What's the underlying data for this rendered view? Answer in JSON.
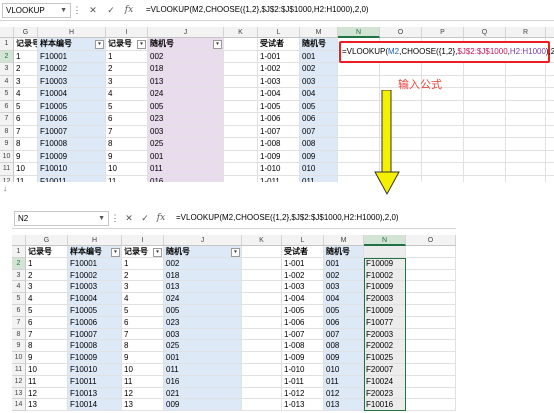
{
  "top": {
    "name_box": "VLOOKUP",
    "btn_more": "⋮",
    "btn_cancel": "✕",
    "btn_enter": "✓",
    "btn_fx": "fx",
    "formula": "=VLOOKUP(M2,CHOOSE({1,2},$J$2:$J$1000,H2:H1000),2,0)",
    "columns": [
      "G",
      "H",
      "I",
      "J",
      "K",
      "L",
      "M",
      "N",
      "O",
      "P",
      "Q",
      "R",
      "S"
    ],
    "rows": [
      "1",
      "2",
      "3",
      "4",
      "5",
      "6",
      "7",
      "8",
      "9",
      "10",
      "11",
      "12"
    ],
    "headers": {
      "g": "记录号",
      "h": "样本编号",
      "i": "记录号",
      "j": "随机号",
      "l": "受试者",
      "m": "随机号"
    },
    "data": [
      {
        "g": "1",
        "h": "F10001",
        "i": "1",
        "j": "002",
        "l": "1-001",
        "m": "001"
      },
      {
        "g": "2",
        "h": "F10002",
        "i": "2",
        "j": "018",
        "l": "1-002",
        "m": "002"
      },
      {
        "g": "3",
        "h": "F10003",
        "i": "3",
        "j": "013",
        "l": "1-003",
        "m": "003"
      },
      {
        "g": "4",
        "h": "F10004",
        "i": "4",
        "j": "024",
        "l": "1-004",
        "m": "004"
      },
      {
        "g": "5",
        "h": "F10005",
        "i": "5",
        "j": "005",
        "l": "1-005",
        "m": "005"
      },
      {
        "g": "6",
        "h": "F10006",
        "i": "6",
        "j": "023",
        "l": "1-006",
        "m": "006"
      },
      {
        "g": "7",
        "h": "F10007",
        "i": "7",
        "j": "003",
        "l": "1-007",
        "m": "007"
      },
      {
        "g": "8",
        "h": "F10008",
        "i": "8",
        "j": "025",
        "l": "1-008",
        "m": "008"
      },
      {
        "g": "9",
        "h": "F10009",
        "i": "9",
        "j": "001",
        "l": "1-009",
        "m": "009"
      },
      {
        "g": "10",
        "h": "F10010",
        "i": "10",
        "j": "011",
        "l": "1-010",
        "m": "010"
      },
      {
        "g": "11",
        "h": "F10011",
        "i": "11",
        "j": "016",
        "l": "1-011",
        "m": "011"
      }
    ],
    "editing_formula": {
      "part1": "=VLOOKUP(",
      "part2": "M2",
      "part3": ",CHOOSE({1,2},",
      "part4": "$J$2:$J$1000",
      "part5": ",",
      "part6": "H2:H1000",
      "part7": "),2,0)"
    },
    "annotation": "输入公式"
  },
  "arrow_note": "↓",
  "bottom": {
    "name_box": "N2",
    "btn_more": "⋮",
    "btn_cancel": "✕",
    "btn_enter": "✓",
    "btn_fx": "fx",
    "formula": "=VLOOKUP(M2,CHOOSE({1,2},$J$2:$J$1000,H2:H1000),2,0)",
    "columns": [
      "G",
      "H",
      "I",
      "J",
      "K",
      "L",
      "M",
      "N",
      "O"
    ],
    "rows": [
      "1",
      "2",
      "3",
      "4",
      "5",
      "6",
      "7",
      "8",
      "9",
      "10",
      "11",
      "12",
      "13",
      "14"
    ],
    "headers": {
      "g": "记录号",
      "h": "样本编号",
      "i": "记录号",
      "j": "随机号",
      "l": "受试者",
      "m": "随机号"
    },
    "data": [
      {
        "g": "1",
        "h": "F10001",
        "i": "1",
        "j": "002",
        "l": "1-001",
        "m": "001",
        "n": "F10009"
      },
      {
        "g": "2",
        "h": "F10002",
        "i": "2",
        "j": "018",
        "l": "1-002",
        "m": "002",
        "n": "F10002"
      },
      {
        "g": "3",
        "h": "F10003",
        "i": "3",
        "j": "013",
        "l": "1-003",
        "m": "003",
        "n": "F10009"
      },
      {
        "g": "4",
        "h": "F10004",
        "i": "4",
        "j": "024",
        "l": "1-004",
        "m": "004",
        "n": "F20003"
      },
      {
        "g": "5",
        "h": "F10005",
        "i": "5",
        "j": "005",
        "l": "1-005",
        "m": "005",
        "n": "F10009"
      },
      {
        "g": "6",
        "h": "F10006",
        "i": "6",
        "j": "023",
        "l": "1-006",
        "m": "006",
        "n": "F10077"
      },
      {
        "g": "7",
        "h": "F10007",
        "i": "7",
        "j": "003",
        "l": "1-007",
        "m": "007",
        "n": "F20003"
      },
      {
        "g": "8",
        "h": "F10008",
        "i": "8",
        "j": "025",
        "l": "1-008",
        "m": "008",
        "n": "F20002"
      },
      {
        "g": "9",
        "h": "F10009",
        "i": "9",
        "j": "001",
        "l": "1-009",
        "m": "009",
        "n": "F10025"
      },
      {
        "g": "10",
        "h": "F10010",
        "i": "10",
        "j": "011",
        "l": "1-010",
        "m": "010",
        "n": "F20007"
      },
      {
        "g": "11",
        "h": "F10011",
        "i": "11",
        "j": "016",
        "l": "1-011",
        "m": "011",
        "n": "F10024"
      },
      {
        "g": "12",
        "h": "F10013",
        "i": "12",
        "j": "021",
        "l": "1-012",
        "m": "012",
        "n": "F20023"
      },
      {
        "g": "13",
        "h": "F10014",
        "i": "13",
        "j": "009",
        "l": "1-013",
        "m": "013",
        "n": "F10016"
      }
    ]
  },
  "colors": {
    "accent_red": "#ee1c25",
    "arrow_yellow": "#f5f000",
    "select_green": "#217346"
  }
}
